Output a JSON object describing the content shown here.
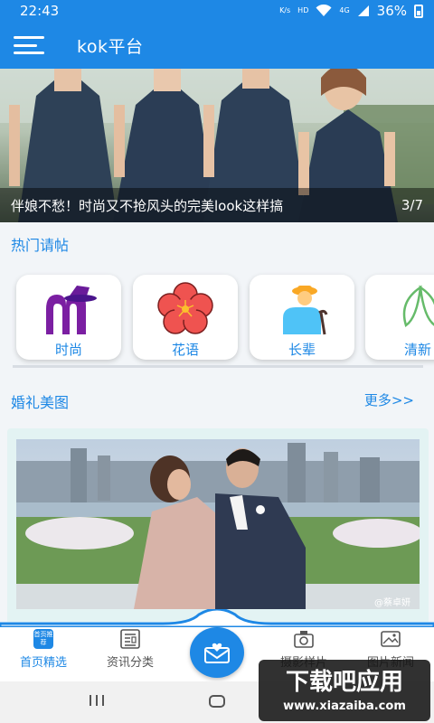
{
  "status_bar": {
    "time": "22:43",
    "net_speed": "K/s",
    "hd": "HD",
    "signal": "4G",
    "battery": "36%"
  },
  "app_bar": {
    "title": "kok平台"
  },
  "banner": {
    "caption": "伴娘不愁！时尚又不抢风头的完美look这样搞",
    "counter": "3/7"
  },
  "hot_section": {
    "title": "热门请帖",
    "categories": [
      {
        "label": "时尚",
        "icon": "fashion-hat-icon"
      },
      {
        "label": "花语",
        "icon": "flower-icon"
      },
      {
        "label": "长辈",
        "icon": "elder-icon"
      },
      {
        "label": "清新",
        "icon": "leaf-icon"
      }
    ]
  },
  "wedding_section": {
    "title": "婚礼美图",
    "more": "更多>>",
    "photo_watermark": "@蔡卓妍"
  },
  "bottom_nav": {
    "items": [
      {
        "label": "首页精选",
        "icon_text": "首页推荐",
        "active": true
      },
      {
        "label": "资讯分类",
        "active": false
      },
      {
        "label": "摄影样片",
        "active": false
      },
      {
        "label": "图片新闻",
        "active": false
      }
    ],
    "center_icon": "envelope-heart-icon"
  },
  "watermark": {
    "line1": "下载吧应用",
    "line2": "www.xiazaiba.com"
  },
  "colors": {
    "primary": "#1e88e5",
    "hot_title": "#1e88e5"
  }
}
